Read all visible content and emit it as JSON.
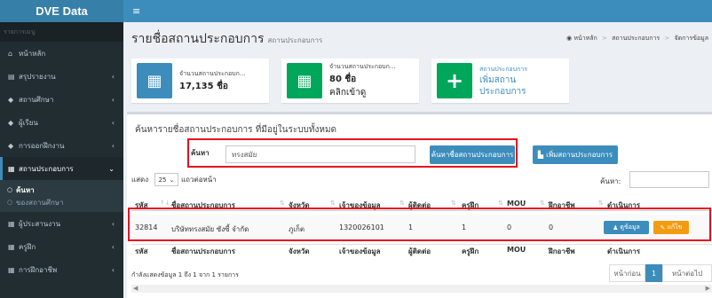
{
  "brand": "DVE Data",
  "sidebar": {
    "header": "รายการเมนู",
    "items": [
      {
        "icon": "home-icon",
        "label": "หน้าหลัก"
      },
      {
        "icon": "report-icon",
        "label": "สรุปรายงาน"
      },
      {
        "icon": "school-icon",
        "label": "สถานศึกษา"
      },
      {
        "icon": "student-icon",
        "label": "ผู้เรียน"
      },
      {
        "icon": "training-icon",
        "label": "การออกฝึกงาน"
      },
      {
        "icon": "building-icon",
        "label": "สถานประกอบการ"
      },
      {
        "icon": "network-icon",
        "label": "ผู้ประสานงาน"
      },
      {
        "icon": "trainer-icon",
        "label": "ครูฝึก"
      },
      {
        "icon": "career-icon",
        "label": "การฝึกอาชีพ"
      }
    ],
    "submenu": [
      "ค้นหา",
      "ของสถานศึกษา"
    ]
  },
  "header": {
    "title": "รายชื่อสถานประกอบการ",
    "subtitle": "สถานประกอบการ",
    "breadcrumb": [
      "หน้าหลัก",
      "สถานประกอบการ",
      "จัดการข้อมูล"
    ]
  },
  "stats": [
    {
      "label": "จำนวนสถานประกอบก...",
      "value": "17,135 ชื่อ",
      "color": "#3c8dbc"
    },
    {
      "label": "จำนวนสถานประกอบก...",
      "value": "80 ชื่อ",
      "link": "คลิกเข้าดู",
      "color": "#00a65a"
    },
    {
      "label": "สถานประกอบการ",
      "line1": "เพิ่มสถาน",
      "line2": "ประกอบการ",
      "color": "#00a65a"
    }
  ],
  "panel": {
    "title": "ค้นหารายชื่อสถานประกอบการ ที่มีอยู่ในระบบทั้งหมด"
  },
  "search": {
    "label": "ค้นหา",
    "value": "ทรงสมัย",
    "button": "ค้นหาชื่อสถานประกอบการ",
    "add_button": "เพิ่มสถานประกอบการ"
  },
  "table_controls": {
    "show_label": "แสดง",
    "page_size": "25",
    "after_label": "แถวต่อหน้า",
    "filter_label": "ค้นหา:"
  },
  "table": {
    "columns": [
      "รหัส",
      "ชื่อสถานประกอบการ",
      "จังหวัด",
      "เจ้าของข้อมูล",
      "ผู้ติดต่อ",
      "ครูฝึก",
      "MOU",
      "ฝึกอาชีพ",
      "ดำเนินการ"
    ],
    "row": {
      "id": "32814",
      "name": "บริษัททรงสมัย ซังซี้ จำกัด",
      "province": "ภูเก็ต",
      "owner": "1320026101",
      "contacts": "1",
      "trainers": "1",
      "mou": "0",
      "jobs": "0",
      "view_btn": "ดูข้อมูล",
      "edit_btn": "แก้ไข"
    }
  },
  "footer": {
    "info": "กำลังแสดงข้อมูล 1 ถึง 1 จาก 1 รายการ",
    "prev": "หน้าก่อน",
    "page": "1",
    "next": "หน้าต่อไป"
  }
}
